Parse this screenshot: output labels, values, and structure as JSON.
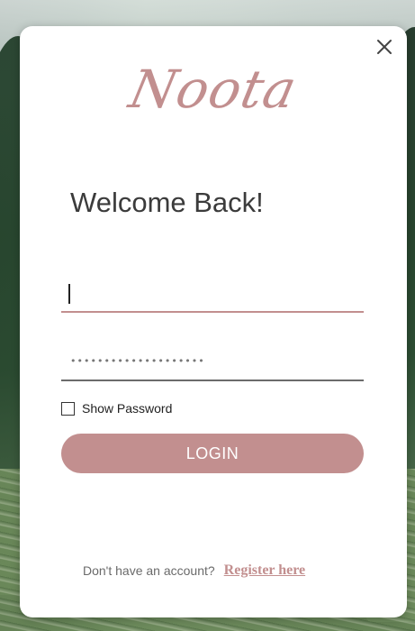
{
  "brand": {
    "logo_text": "Noota",
    "accent_color": "#c28f8f"
  },
  "dialog": {
    "close_icon": "close-icon",
    "title": "Welcome Back!"
  },
  "form": {
    "username": {
      "value": "",
      "placeholder": ""
    },
    "password": {
      "masked_value": "••••••••••••••••••••"
    },
    "show_password": {
      "label": "Show Password",
      "checked": false
    },
    "login_label": "LOGIN"
  },
  "footer": {
    "prompt": "Don't have an account?",
    "register_link": "Register here"
  }
}
